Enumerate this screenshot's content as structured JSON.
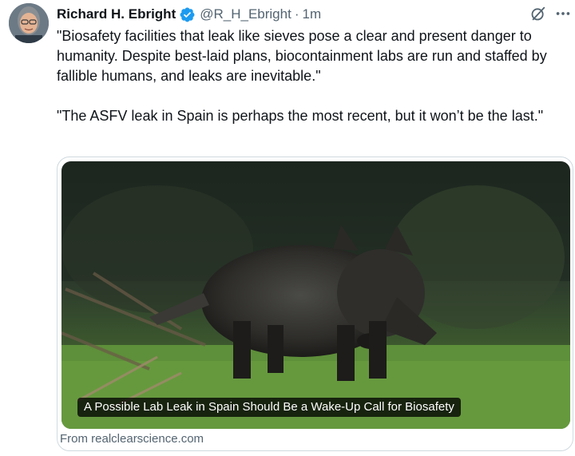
{
  "tweet": {
    "author": {
      "display_name": "Richard H. Ebright",
      "handle": "@R_H_Ebright",
      "verified": true,
      "avatar_icon": "avatar-photo"
    },
    "separator": "·",
    "timestamp": "1m",
    "paragraphs": [
      "\"Biosafety facilities that leak like sieves pose a clear and present danger to humanity. Despite best-laid plans, biocontainment labs are run and staffed by fallible humans, and leaks are inevitable.\"",
      "\"The ASFV leak in Spain is perhaps the most recent, but it won’t be the last.\""
    ],
    "card": {
      "title": "A Possible Lab Leak in Spain Should Be a Wake-Up Call for Biosafety",
      "source": "From realclearscience.com"
    }
  },
  "icons": {
    "verified": "verified-badge-icon",
    "grok": "grok-icon",
    "more": "more-icon"
  },
  "colors": {
    "text_primary": "#0f1419",
    "text_secondary": "#536471",
    "verified_blue": "#1d9bf0",
    "card_border": "#cfd9de"
  }
}
